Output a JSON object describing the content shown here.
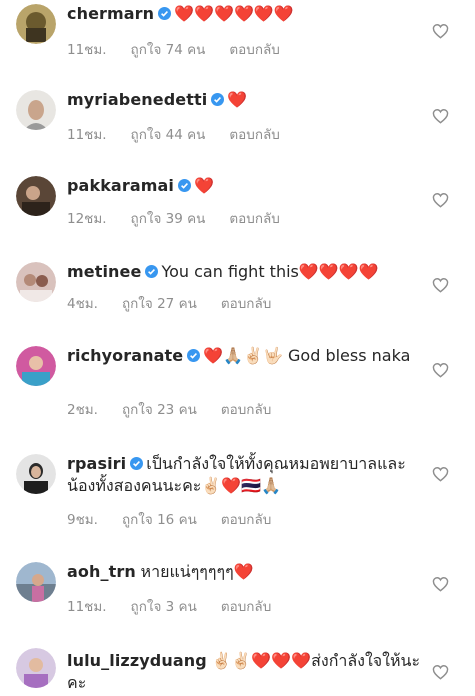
{
  "comments": [
    {
      "username": "chermarn",
      "verified": true,
      "text": "❤️❤️❤️❤️❤️❤️",
      "time": "11ชม.",
      "likes": "ถูกใจ 74 คน",
      "reply": "ตอบกลับ"
    },
    {
      "username": "myriabenedetti",
      "verified": true,
      "text": "❤️",
      "time": "11ชม.",
      "likes": "ถูกใจ 44 คน",
      "reply": "ตอบกลับ"
    },
    {
      "username": "pakkaramai",
      "verified": true,
      "text": "❤️",
      "time": "12ชม.",
      "likes": "ถูกใจ 39 คน",
      "reply": "ตอบกลับ"
    },
    {
      "username": "metinee",
      "verified": true,
      "text": "You can fight this❤️❤️❤️❤️",
      "time": "4ชม.",
      "likes": "ถูกใจ 27 คน",
      "reply": "ตอบกลับ"
    },
    {
      "username": "richyoranate",
      "verified": true,
      "text": "❤️🙏🏼✌🏻🤟🏻 God bless naka",
      "time": "2ชม.",
      "likes": "ถูกใจ 23 คน",
      "reply": "ตอบกลับ"
    },
    {
      "username": "rpasiri",
      "verified": true,
      "text": "เป็นกำลังใจให้ทั้งคุณหมอพยาบาลและน้องทั้งสองคนนะคะ✌🏻❤️🇹🇭🙏🏼",
      "time": "9ชม.",
      "likes": "ถูกใจ 16 คน",
      "reply": "ตอบกลับ"
    },
    {
      "username": "aoh_trn",
      "verified": false,
      "text": "หายแน่ๆๆๆๆๆ❤️",
      "time": "11ชม.",
      "likes": "ถูกใจ 3 คน",
      "reply": "ตอบกลับ"
    },
    {
      "username": "lulu_lizzyduang",
      "verified": false,
      "text": "✌🏻✌🏻❤️❤️❤️ส่งกำลังใจให้นะคะ",
      "time": "",
      "likes": "",
      "reply": ""
    }
  ],
  "icons": {
    "like": "heart-outline-icon",
    "verified": "verified-badge-icon"
  },
  "colors": {
    "verified": "#3897f0",
    "meta": "#8e8e8e",
    "text": "#262626"
  }
}
